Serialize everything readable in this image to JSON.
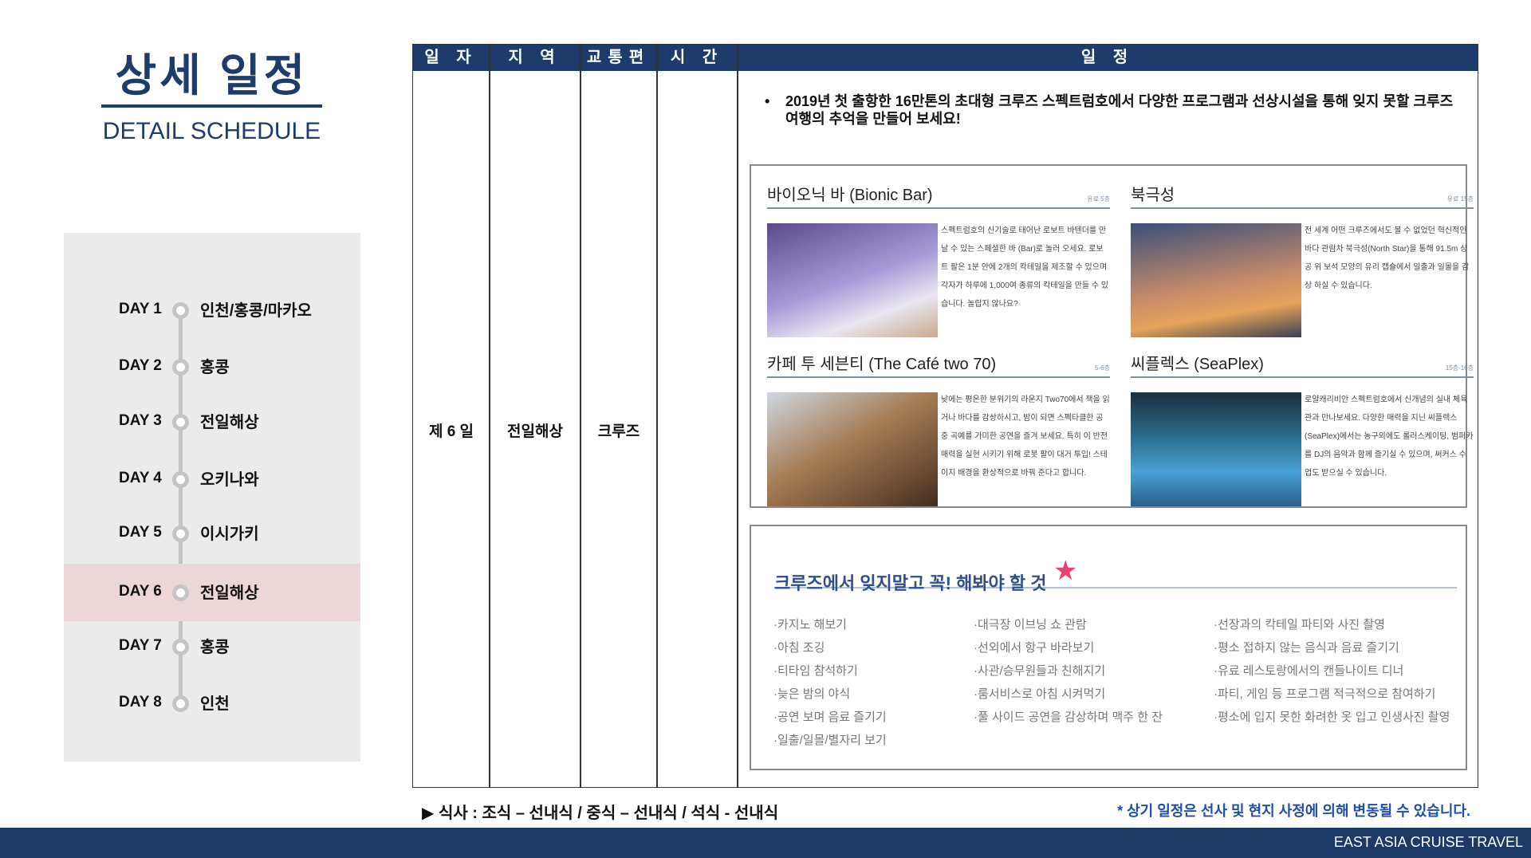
{
  "header": {
    "title": "상세 일정",
    "subtitle": "DETAIL SCHEDULE"
  },
  "sidebar": {
    "days": [
      {
        "label": "DAY 1",
        "place": "인천/홍콩/마카오"
      },
      {
        "label": "DAY 2",
        "place": "홍콩"
      },
      {
        "label": "DAY 3",
        "place": "전일해상"
      },
      {
        "label": "DAY 4",
        "place": "오키나와"
      },
      {
        "label": "DAY 5",
        "place": "이시가키"
      },
      {
        "label": "DAY 6",
        "place": "전일해상",
        "active": true
      },
      {
        "label": "DAY 7",
        "place": "홍콩"
      },
      {
        "label": "DAY 8",
        "place": "인천"
      }
    ]
  },
  "table": {
    "headers": [
      "일 자",
      "지 역",
      "교통편",
      "시 간",
      "일 정"
    ],
    "row": {
      "day": "제 6 일",
      "region": "전일해상",
      "transport": "크루즈",
      "time": ""
    },
    "intro": "2019년 첫 출항한 16만톤의 초대형 크루즈 스펙트럼호에서 다양한 프로그램과 선상시설을 통해 잊지 못할 크루즈 여행의 추억을 만들어 보세요!",
    "cards": [
      {
        "title": "바이오닉 바 (Bionic Bar)",
        "tags": "유료  5층",
        "text": "스펙트럼호의 신기술로 태어난 로보트 바텐더를 만날 수 있는 스페셜한 바 (Bar)로 놀러 오세요. 로보트 팔은 1분 안에 2개의 칵테일을 제조할 수 있으며 각자가 하루에 1,000여 종류의 칵테일을 만들 수 있습니다. 놀랍지 않나요?"
      },
      {
        "title": "북극성",
        "tags": "유료  15층",
        "text": "전 세계 어떤 크루즈에서도 볼 수 없었던 혁신적인 바다 관람차 북극성(North Star)을 통해 91.5m 상공 위 보석 모양의 유리 캡슐에서 일출과 일몰을 감상 하실 수 있습니다."
      },
      {
        "title": "카페 투 세븐티 (The Café two 70)",
        "tags": "5-6층",
        "text": "낮에는 평온한 분위기의 라운지 Two70에서 책을 읽거나 바다를 감상하시고, 밤이 되면 스펙타클한 공중 곡예를 가미한 공연을 즐겨 보세요. 특히 이 반전 매력을 실현 시키기 위해 로봇 팔이 대거 투입! 스테이지 배경을 환상적으로 바꿔 준다고 합니다."
      },
      {
        "title": "씨플렉스 (SeaPlex)",
        "tags": "15층-16층",
        "text": "로얄캐리비안 스펙트럼호에서 신개념의 실내 체육관과 만나보세요. 다양한 매력을 지닌 씨플렉스(SeaPlex)에서는 농구외에도 롤러스케이팅, 범퍼카를 DJ의 음악과 함께 즐기실 수 있으며, 써커스 수업도 받으실 수 있습니다."
      }
    ],
    "mustdo": {
      "title": "크루즈에서 잊지말고 꼭! 해봐야 할 것",
      "columns": [
        [
          "·카지노 해보기",
          "·아침 조깅",
          "·티타임 참석하기",
          "·늦은 밤의 야식",
          "·공연 보며 음료 즐기기",
          "·일출/일몰/별자리 보기"
        ],
        [
          "·대극장 이브닝 쇼 관람",
          "·선외에서 항구 바라보기",
          "·사관/승무원들과 친해지기",
          "·룸서비스로 아침 시켜먹기",
          "·풀 사이드 공연을 감상하며 맥주 한 잔"
        ],
        [
          "·선장과의 칵테일 파티와 사진 촬영",
          "·평소 접하지 않는 음식과 음료 즐기기",
          "·유료 레스토랑에서의 캔들나이트 디너",
          "·파티, 게임 등 프로그램 적극적으로 참여하기",
          "·평소에 입지 못한 화려한 옷 입고 인생사진 촬영"
        ]
      ]
    }
  },
  "footer": {
    "meal": "▶ 식사 : 조식 – 선내식 / 중식 – 선내식 / 석식 - 선내식",
    "note": "* 상기 일정은 선사 및 현지 사정에 의해 변동될 수 있습니다.",
    "brand": "EAST ASIA CRUISE TRAVEL"
  },
  "colors": {
    "navy": "#1d3c6b",
    "highlight": "#ecd6d8",
    "star": "#e8436e"
  }
}
